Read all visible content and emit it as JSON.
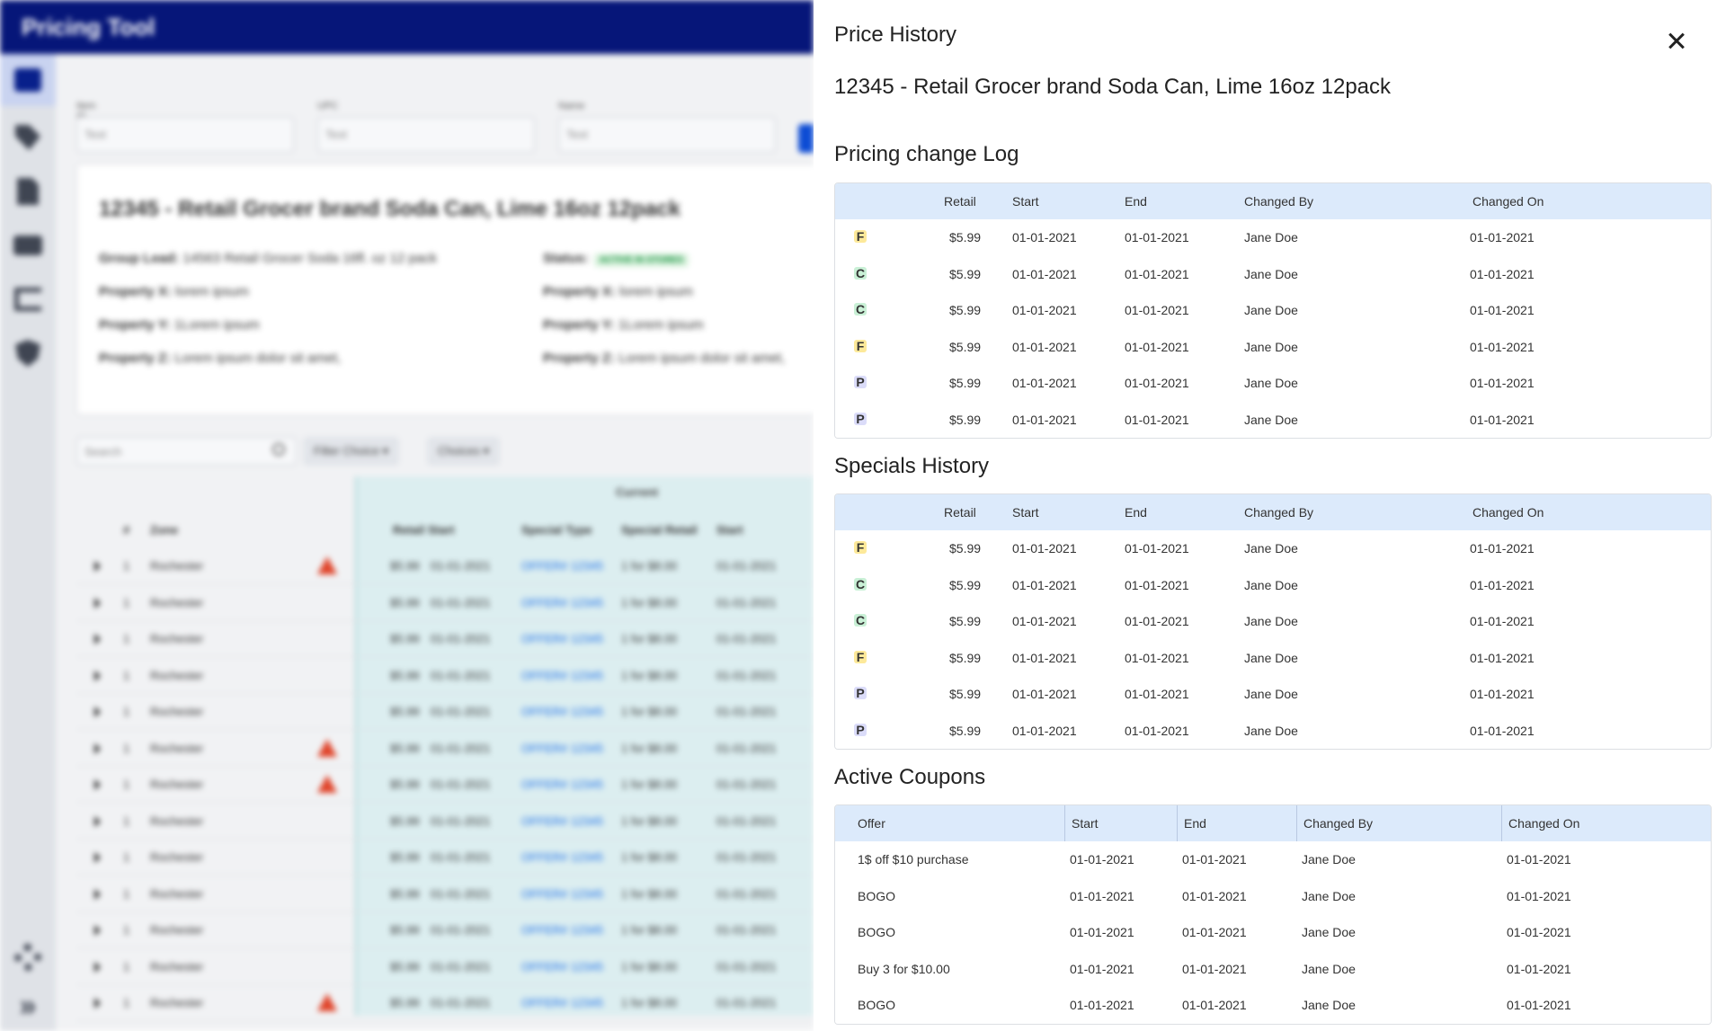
{
  "app": {
    "title": "Pricing Tool",
    "filters": [
      {
        "label": "Item ID",
        "placeholder": "Text"
      },
      {
        "label": "UPC",
        "placeholder": "Text"
      },
      {
        "label": "Name",
        "placeholder": "Text"
      }
    ],
    "card": {
      "title": "12345 - Retail Grocer brand Soda Can, Lime 16oz 12pack",
      "left": [
        {
          "label": "Group Lead:",
          "value": "14563 Retail Grocer Soda 16fl. oz 12 pack"
        },
        {
          "label": "Property X:",
          "value": "lorem ipsum"
        },
        {
          "label": "Property Y:",
          "value": "1Lorem ipsum"
        },
        {
          "label": "Property Z:",
          "value": "Lorem ipsum dolor sit amet,"
        }
      ],
      "right": [
        {
          "label": "Status:",
          "value": "ACTIVE IN STORES"
        },
        {
          "label": "Property X:",
          "value": "lorem ipsum"
        },
        {
          "label": "Property Y:",
          "value": "1Lorem ipsum"
        },
        {
          "label": "Property Z:",
          "value": "Lorem ipsum dolor sit amet,"
        }
      ]
    },
    "toolbar": {
      "search_placeholder": "Search",
      "filter_choice": "Filter Choice",
      "choices": "Choices"
    },
    "grid": {
      "group_label": "Current",
      "headers": [
        "#",
        "Zone",
        "Retail",
        "Start",
        "Special Type",
        "Special Retail",
        "Start"
      ],
      "rows": [
        {
          "num": "1",
          "zone": "Rochester",
          "warn": true,
          "retail": "$5.99",
          "start": "01-01-2021",
          "special_type": "OFFER# 12345",
          "special_retail": "1 for $8.00",
          "start2": "01-01-2021"
        },
        {
          "num": "1",
          "zone": "Rochester",
          "warn": false,
          "retail": "$5.99",
          "start": "01-01-2021",
          "special_type": "OFFER# 12345",
          "special_retail": "1 for $8.00",
          "start2": "01-01-2021"
        },
        {
          "num": "1",
          "zone": "Rochester",
          "warn": false,
          "retail": "$5.99",
          "start": "01-01-2021",
          "special_type": "OFFER# 12345",
          "special_retail": "1 for $8.00",
          "start2": "01-01-2021"
        },
        {
          "num": "1",
          "zone": "Rochester",
          "warn": false,
          "retail": "$5.99",
          "start": "01-01-2021",
          "special_type": "OFFER# 12345",
          "special_retail": "1 for $8.00",
          "start2": "01-01-2021"
        },
        {
          "num": "1",
          "zone": "Rochester",
          "warn": false,
          "retail": "$5.99",
          "start": "01-01-2021",
          "special_type": "OFFER# 12345",
          "special_retail": "1 for $8.00",
          "start2": "01-01-2021"
        },
        {
          "num": "1",
          "zone": "Rochester",
          "warn": true,
          "retail": "$5.99",
          "start": "01-01-2021",
          "special_type": "OFFER# 12345",
          "special_retail": "1 for $8.00",
          "start2": "01-01-2021"
        },
        {
          "num": "1",
          "zone": "Rochester",
          "warn": true,
          "retail": "$5.99",
          "start": "01-01-2021",
          "special_type": "OFFER# 12345",
          "special_retail": "1 for $8.00",
          "start2": "01-01-2021"
        },
        {
          "num": "1",
          "zone": "Rochester",
          "warn": false,
          "retail": "$5.99",
          "start": "01-01-2021",
          "special_type": "OFFER# 12345",
          "special_retail": "1 for $8.00",
          "start2": "01-01-2021"
        },
        {
          "num": "1",
          "zone": "Rochester",
          "warn": false,
          "retail": "$5.99",
          "start": "01-01-2021",
          "special_type": "OFFER# 12345",
          "special_retail": "1 for $8.00",
          "start2": "01-01-2021"
        },
        {
          "num": "1",
          "zone": "Rochester",
          "warn": false,
          "retail": "$5.99",
          "start": "01-01-2021",
          "special_type": "OFFER# 12345",
          "special_retail": "1 for $8.00",
          "start2": "01-01-2021"
        },
        {
          "num": "1",
          "zone": "Rochester",
          "warn": false,
          "retail": "$5.99",
          "start": "01-01-2021",
          "special_type": "OFFER# 12345",
          "special_retail": "1 for $8.00",
          "start2": "01-01-2021"
        },
        {
          "num": "1",
          "zone": "Rochester",
          "warn": false,
          "retail": "$5.99",
          "start": "01-01-2021",
          "special_type": "OFFER# 12345",
          "special_retail": "1 for $8.00",
          "start2": "01-01-2021"
        },
        {
          "num": "1",
          "zone": "Rochester",
          "warn": true,
          "retail": "$5.99",
          "start": "01-01-2021",
          "special_type": "OFFER# 12345",
          "special_retail": "1 for $8.00",
          "start2": "01-01-2021"
        }
      ]
    }
  },
  "drawer": {
    "title": "Price History",
    "product": "12345 - Retail Grocer brand Soda Can, Lime 16oz 12pack",
    "pricing_log": {
      "title": "Pricing change Log",
      "headers": [
        "Retail",
        "Start",
        "End",
        "Changed By",
        "Changed On"
      ],
      "rows": [
        {
          "badge": "F",
          "retail": "$5.99",
          "start": "01-01-2021",
          "end": "01-01-2021",
          "by": "Jane Doe",
          "on": "01-01-2021"
        },
        {
          "badge": "C",
          "retail": "$5.99",
          "start": "01-01-2021",
          "end": "01-01-2021",
          "by": "Jane Doe",
          "on": "01-01-2021"
        },
        {
          "badge": "C",
          "retail": "$5.99",
          "start": "01-01-2021",
          "end": "01-01-2021",
          "by": "Jane Doe",
          "on": "01-01-2021"
        },
        {
          "badge": "F",
          "retail": "$5.99",
          "start": "01-01-2021",
          "end": "01-01-2021",
          "by": "Jane Doe",
          "on": "01-01-2021"
        },
        {
          "badge": "P",
          "retail": "$5.99",
          "start": "01-01-2021",
          "end": "01-01-2021",
          "by": "Jane Doe",
          "on": "01-01-2021"
        },
        {
          "badge": "P",
          "retail": "$5.99",
          "start": "01-01-2021",
          "end": "01-01-2021",
          "by": "Jane Doe",
          "on": "01-01-2021"
        }
      ]
    },
    "specials": {
      "title": "Specials History",
      "headers": [
        "Retail",
        "Start",
        "End",
        "Changed By",
        "Changed On"
      ],
      "rows": [
        {
          "badge": "F",
          "retail": "$5.99",
          "start": "01-01-2021",
          "end": "01-01-2021",
          "by": "Jane Doe",
          "on": "01-01-2021"
        },
        {
          "badge": "C",
          "retail": "$5.99",
          "start": "01-01-2021",
          "end": "01-01-2021",
          "by": "Jane Doe",
          "on": "01-01-2021"
        },
        {
          "badge": "C",
          "retail": "$5.99",
          "start": "01-01-2021",
          "end": "01-01-2021",
          "by": "Jane Doe",
          "on": "01-01-2021"
        },
        {
          "badge": "F",
          "retail": "$5.99",
          "start": "01-01-2021",
          "end": "01-01-2021",
          "by": "Jane Doe",
          "on": "01-01-2021"
        },
        {
          "badge": "P",
          "retail": "$5.99",
          "start": "01-01-2021",
          "end": "01-01-2021",
          "by": "Jane Doe",
          "on": "01-01-2021"
        },
        {
          "badge": "P",
          "retail": "$5.99",
          "start": "01-01-2021",
          "end": "01-01-2021",
          "by": "Jane Doe",
          "on": "01-01-2021"
        }
      ]
    },
    "coupons": {
      "title": "Active Coupons",
      "headers": [
        "Offer",
        "Start",
        "End",
        "Changed By",
        "Changed On"
      ],
      "rows": [
        {
          "offer": "1$ off $10 purchase",
          "start": "01-01-2021",
          "end": "01-01-2021",
          "by": "Jane Doe",
          "on": "01-01-2021"
        },
        {
          "offer": "BOGO",
          "start": "01-01-2021",
          "end": "01-01-2021",
          "by": "Jane Doe",
          "on": "01-01-2021"
        },
        {
          "offer": "BOGO",
          "start": "01-01-2021",
          "end": "01-01-2021",
          "by": "Jane Doe",
          "on": "01-01-2021"
        },
        {
          "offer": "Buy 3 for $10.00",
          "start": "01-01-2021",
          "end": "01-01-2021",
          "by": "Jane Doe",
          "on": "01-01-2021"
        },
        {
          "offer": "BOGO",
          "start": "01-01-2021",
          "end": "01-01-2021",
          "by": "Jane Doe",
          "on": "01-01-2021"
        }
      ]
    }
  }
}
